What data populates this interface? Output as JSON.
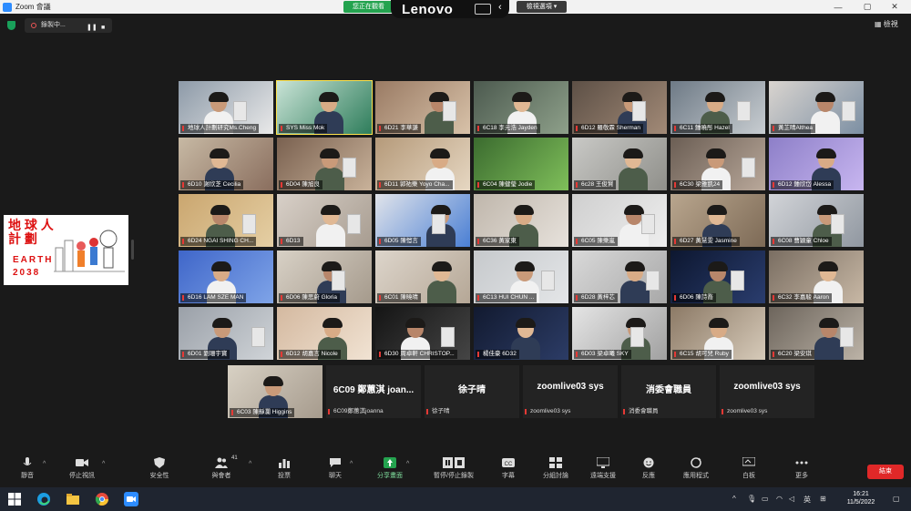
{
  "window": {
    "title": "Zoom 會議",
    "controls": {
      "minimize": "—",
      "maximize": "▢",
      "close": "✕"
    }
  },
  "share_banner": {
    "status": "您正在觀看",
    "brand": "Lenovo",
    "view_options": "檢視選項"
  },
  "recording": {
    "label": "錄製中...",
    "pause": "❚❚",
    "stop": "■"
  },
  "view_button": "檢視",
  "shared_content": {
    "heading_line1": "地 球 人",
    "heading_line2": "計 劃",
    "title_en": "EARTH",
    "year": "2038"
  },
  "participants": [
    "地球人計劃研究Ms.Cheng",
    "SYS Miss Mok",
    "6D21 李華謙",
    "6C18 李元浩 Jayden",
    "6D12 羅敬霖 Sherman",
    "6C11 鍾曉彤 Hazel",
    "黃芷晴Althea",
    "6D10 謝欣芝 Cecilia",
    "6D04 陳旭良",
    "6D11 郭祐樂 Yoyo Cha...",
    "6C04 陳健瑩 Jodie",
    "6c28 王俊賢",
    "6C30 梁雅凱24",
    "6D12 鍾欣岱 Alessa",
    "6D24 NGAI SHING CH...",
    "6D13",
    "6D05 陳愷言",
    "6C36 黃家東",
    "6C05 陳樂嵐",
    "6D27 黃慧雯 Jasmine",
    "6C08 曹穎童 Chloe",
    "6D16 LAM SZE MAN",
    "6D06 陳思蔚 Gloria",
    "6C01 陳曉晴",
    "6C13 HUI CHUN ...",
    "6D28 黃梓芯",
    "6D06 陳詩喬",
    "6C32 李嘉駿 Aaron",
    "6D01 劉珊宇寶",
    "6D12 胡嘉言 Nicole",
    "6D30 周卓軒 CHRISTOP...",
    "楊佳豪 6D32",
    "6D03 梁卓曦 SKY",
    "6C15 胡可兒 Ruby",
    "6C20 梁安琪"
  ],
  "last_row_video": "6C03 陳靜瀾 Higgins",
  "name_tiles": [
    {
      "big": "6C09 鄭蕙淇 joan...",
      "small": "6C09鄭蕙淇joanna"
    },
    {
      "big": "徐子晴",
      "small": "徐子晴"
    },
    {
      "big": "zoomlive03 sys",
      "small": "zoomlive03 sys"
    },
    {
      "big": "消委會職員",
      "small": "消委會職員"
    },
    {
      "big": "zoomlive03 sys",
      "small": "zoomlive03 sys"
    }
  ],
  "toolbar": {
    "mute": "靜音",
    "stop_video": "停止視訊",
    "security": "安全性",
    "participants": "與會者",
    "participants_count": "41",
    "polls": "投票",
    "chat": "聊天",
    "share_screen": "分享畫面",
    "pause_recording": "暫停/停止錄製",
    "captions": "字幕",
    "breakout": "分組討論",
    "remote_support": "遠端支援",
    "reactions": "反應",
    "apps": "應用程式",
    "whiteboard": "白板",
    "more": "更多",
    "end": "結束"
  },
  "taskbar": {
    "ime": "英",
    "time": "16:21",
    "date": "11/5/2022"
  },
  "colors": {
    "meeting_bg": "#1a1a1a",
    "end_button": "#e02828",
    "share_green": "#24a34f",
    "active_speaker": "#ffe44d",
    "earth_red": "#d11111"
  }
}
